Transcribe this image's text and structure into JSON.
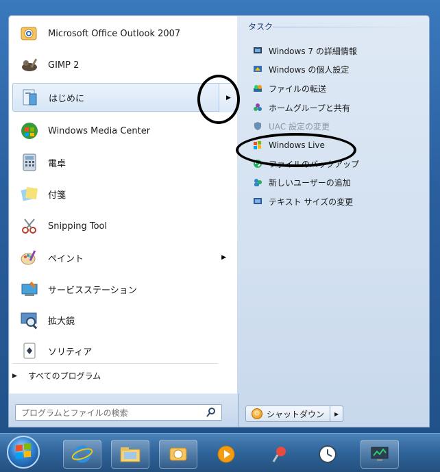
{
  "start_menu": {
    "programs": [
      {
        "label": "Microsoft Office Outlook 2007",
        "icon": "outlook-icon"
      },
      {
        "label": "GIMP 2",
        "icon": "gimp-icon"
      },
      {
        "label": "はじめに",
        "icon": "getting-started-icon",
        "has_submenu": true,
        "selected": true
      },
      {
        "label": "Windows Media Center",
        "icon": "media-center-icon"
      },
      {
        "label": "電卓",
        "icon": "calculator-icon"
      },
      {
        "label": "付箋",
        "icon": "sticky-notes-icon"
      },
      {
        "label": "Snipping Tool",
        "icon": "snipping-tool-icon"
      },
      {
        "label": "ペイント",
        "icon": "paint-icon",
        "has_submenu": true
      },
      {
        "label": "サービスステーション",
        "icon": "service-station-icon"
      },
      {
        "label": "拡大鏡",
        "icon": "magnifier-icon"
      },
      {
        "label": "ソリティア",
        "icon": "solitaire-icon"
      }
    ],
    "all_programs_label": "すべてのプログラム",
    "search_placeholder": "プログラムとファイルの検索",
    "tasks": {
      "title": "タスク",
      "items": [
        {
          "label": "Windows 7 の詳細情報",
          "icon": "info-icon"
        },
        {
          "label": "Windows の個人設定",
          "icon": "personalize-icon"
        },
        {
          "label": "ファイルの転送",
          "icon": "transfer-icon"
        },
        {
          "label": "ホームグループと共有",
          "icon": "homegroup-icon"
        },
        {
          "label": "UAC 設定の変更",
          "icon": "uac-icon",
          "faded": true
        },
        {
          "label": "Windows Live",
          "icon": "windows-live-icon"
        },
        {
          "label": "ファイルのバックアップ",
          "icon": "backup-icon"
        },
        {
          "label": "新しいユーザーの追加",
          "icon": "add-user-icon"
        },
        {
          "label": "テキスト サイズの変更",
          "icon": "text-size-icon"
        }
      ]
    },
    "shutdown_label": "シャットダウン"
  },
  "taskbar": {
    "icons": [
      "start-orb-icon",
      "internet-explorer-icon",
      "explorer-folder-icon",
      "outlook-icon",
      "media-player-icon",
      "pushpin-icon",
      "clock-icon",
      "network-monitor-icon"
    ]
  },
  "colors": {
    "frame_blue": "#2a5f9e",
    "annotation": "#000000"
  }
}
